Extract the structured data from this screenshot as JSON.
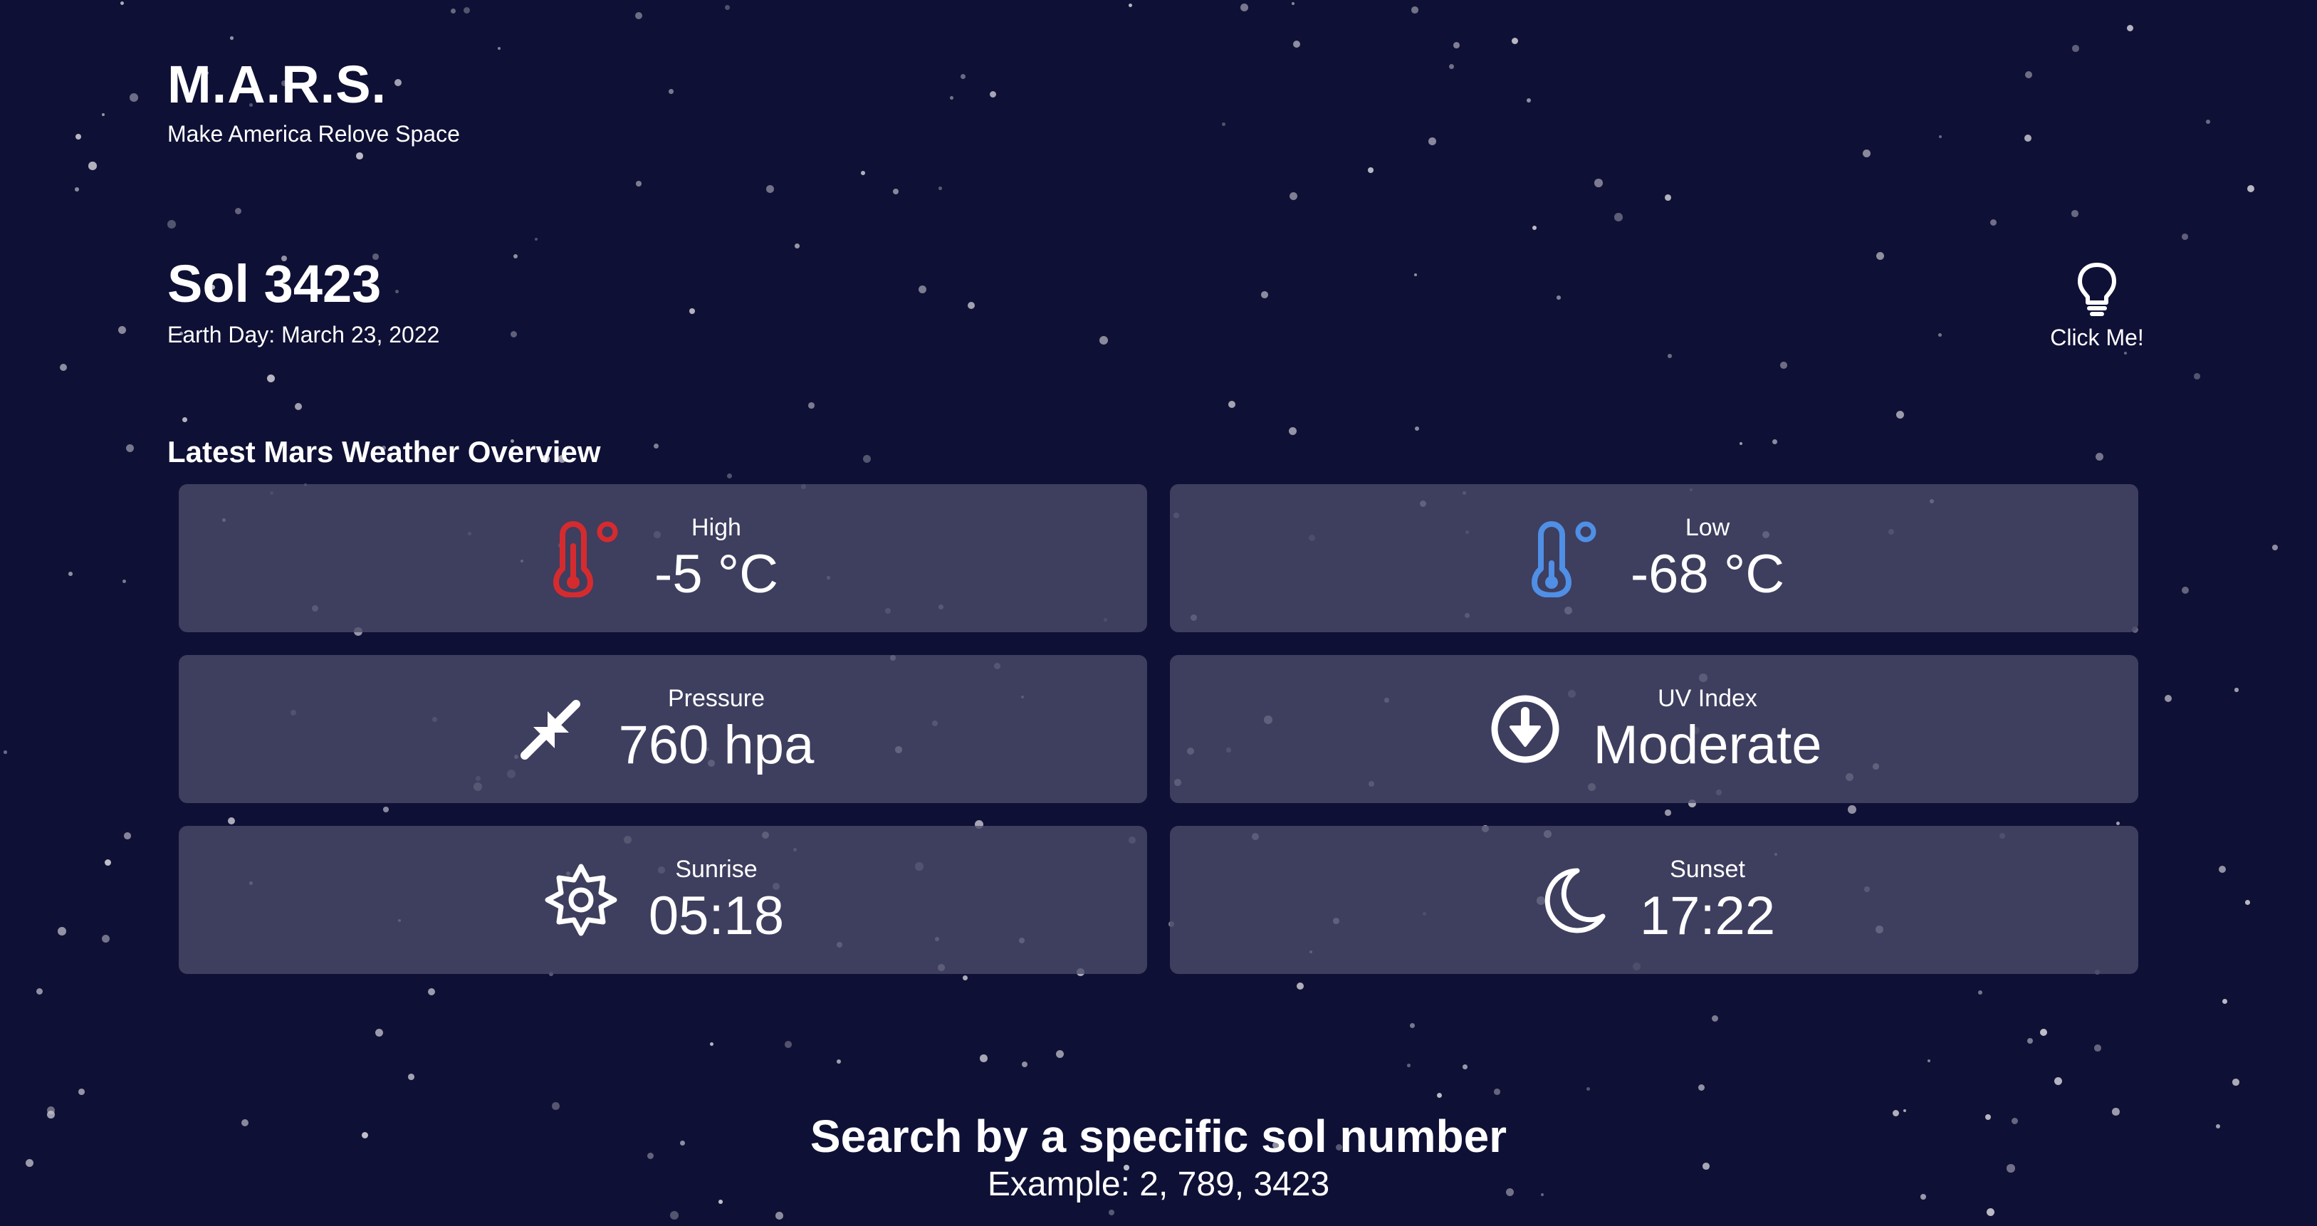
{
  "brand": {
    "title": "M.A.R.S.",
    "tagline": "Make America Relove Space"
  },
  "sol": {
    "title": "Sol 3423",
    "earth_day": "Earth Day: March 23, 2022"
  },
  "idea_button": {
    "label": "Click Me!",
    "icon": "lightbulb-icon"
  },
  "overview": {
    "title": "Latest Mars Weather Overview",
    "cards": [
      {
        "id": "high",
        "label": "High",
        "value": "-5 °C",
        "icon": "thermometer-icon",
        "icon_color": "#d52b2f"
      },
      {
        "id": "low",
        "label": "Low",
        "value": "-68 °C",
        "icon": "thermometer-icon",
        "icon_color": "#4f8fe6"
      },
      {
        "id": "pressure",
        "label": "Pressure",
        "value": "760 hpa",
        "icon": "compress-arrows-icon",
        "icon_color": "#ffffff"
      },
      {
        "id": "uv",
        "label": "UV Index",
        "value": "Moderate",
        "icon": "arrow-circle-down-icon",
        "icon_color": "#ffffff"
      },
      {
        "id": "sunrise",
        "label": "Sunrise",
        "value": "05:18",
        "icon": "sun-icon",
        "icon_color": "#ffffff"
      },
      {
        "id": "sunset",
        "label": "Sunset",
        "value": "17:22",
        "icon": "moon-icon",
        "icon_color": "#ffffff"
      }
    ]
  },
  "search": {
    "title": "Search by a specific sol number",
    "example": "Example: 2, 789, 3423"
  },
  "colors": {
    "background": "#0f1035",
    "card": "#4c4c6c",
    "text": "#ffffff",
    "star": "#c9c8d2"
  }
}
